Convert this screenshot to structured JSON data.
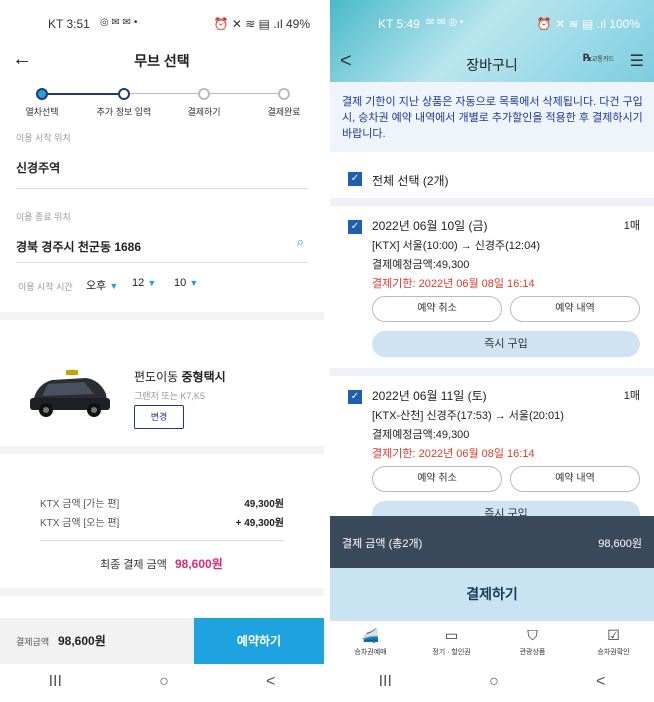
{
  "left": {
    "status": {
      "time": "KT 3:51",
      "icons": "◎ ✉ ✉ •",
      "right": "⏰ ✕ ≋ ▤ .ıl 49%"
    },
    "header": {
      "back": "←",
      "title": "무브 선택"
    },
    "steps": [
      "열차선택",
      "추가 정보 입력",
      "결제하기",
      "결제완료"
    ],
    "start_label": "이용 시작 위치",
    "start_value": "신경주역",
    "end_label": "이용 종료 위치",
    "end_value": "경북 경주시 천군동   1686",
    "time_label": "이용 시작 시간",
    "time_ampm": "오후",
    "time_hour": "12",
    "time_min": "10",
    "car_title_prefix": "편도이동 ",
    "car_title_bold": "중형택시",
    "car_sub": "그랜저 또는 K7,K5",
    "change_btn": "변경",
    "fare_go_label": "KTX 금액 [가는 편]",
    "fare_go_value": "49,300원",
    "fare_back_label": "KTX 금액 [오는 편]",
    "fare_back_value": "+ 49,300원",
    "final_label": "최종 결제 금액",
    "final_value": "98,600원",
    "bottom_label": "결제금액",
    "bottom_value": "98,600원",
    "reserve_btn": "예약하기"
  },
  "right": {
    "status": {
      "time": "KT 5:49",
      "icons": "✉ ✉ ◎ •",
      "right": "⏰ ✕ ≋ ▤ .ıl 100%"
    },
    "header": {
      "back": "<",
      "title": "장바구니",
      "card_icon": "교통카드",
      "menu": "☰"
    },
    "notice": "결제 기한이 지난 상품은 자동으로 목록에서 삭제됩니다. 다건 구입 시, 승차권 예약 내역에서 개별로 추가할인을 적용한 후 결제하시기 바랍니다.",
    "select_all": "전체 선택 (2개)",
    "tickets": [
      {
        "date": "2022년 06월 10일 (금)",
        "count": "1매",
        "route": "[KTX] 서울(10:00) → 신경주(12:04)",
        "amount": "결제예정금액:49,300",
        "deadline": "결제기한: 2022년 06월 08일 16:14",
        "cancel": "예약 취소",
        "detail": "예약 내역",
        "buy": "즉시 구입"
      },
      {
        "date": "2022년 06월 11일 (토)",
        "count": "1매",
        "route": "[KTX-산천] 신경주(17:53) → 서울(20:01)",
        "amount": "결제예정금액:49,300",
        "deadline": "결제기한: 2022년 06월 08일 16:14",
        "cancel": "예약 취소",
        "detail": "예약 내역",
        "buy": "즉시 구입"
      }
    ],
    "sum_label": "결제 금액 (총2개)",
    "sum_value": "98,600원",
    "pay_btn": "결제하기",
    "tabs": [
      "승차권예매",
      "정기 · 할인권",
      "관광상품",
      "승차권확인"
    ]
  },
  "sysnav": {
    "recent": "III",
    "home": "○",
    "back": "<"
  }
}
